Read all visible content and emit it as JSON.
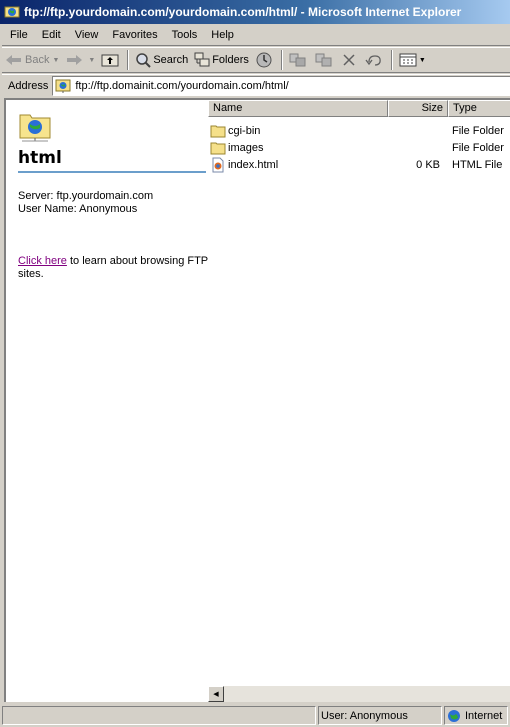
{
  "window": {
    "title": "ftp://ftp.yourdomain.com/yourdomain.com/html/ - Microsoft Internet Explorer"
  },
  "menu": [
    "File",
    "Edit",
    "View",
    "Favorites",
    "Tools",
    "Help"
  ],
  "toolbar": {
    "back_label": "Back",
    "search_label": "Search",
    "folders_label": "Folders"
  },
  "address": {
    "label": "Address",
    "value": "ftp://ftp.domainit.com/yourdomain.com/html/"
  },
  "left_pane": {
    "folder_name": "html",
    "server_line": "Server: ftp.yourdomain.com",
    "user_line": "User Name: Anonymous",
    "link_text": "Click here",
    "link_suffix": " to learn about browsing FTP sites."
  },
  "file_list": {
    "columns": {
      "name": "Name",
      "size": "Size",
      "type": "Type"
    },
    "rows": [
      {
        "name": "cgi-bin",
        "size": "",
        "type": "File Folder",
        "icon": "folder-icon"
      },
      {
        "name": "images",
        "size": "",
        "type": "File Folder",
        "icon": "folder-icon"
      },
      {
        "name": "index.html",
        "size": "0 KB",
        "type": "HTML File",
        "icon": "html-file-icon"
      }
    ]
  },
  "status": {
    "main": "",
    "user": "User: Anonymous",
    "zone": "Internet"
  }
}
